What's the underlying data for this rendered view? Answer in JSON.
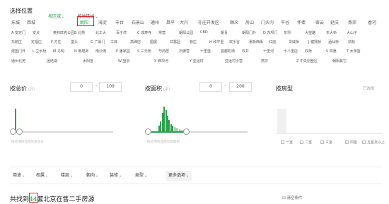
{
  "location": {
    "title": "选择位置",
    "tab_district": "按区域",
    "tab_subway": "按地铁线",
    "districts": [
      "东城",
      "西城",
      "朝阳",
      "海淀",
      "丰台",
      "石景山",
      "通州",
      "昌平",
      "大兴",
      "亦庄开发区",
      "顺义",
      "房山",
      "门头沟",
      "平谷",
      "怀柔",
      "密云",
      "延庆",
      "燕郊",
      "香河"
    ],
    "selected_district": "朝阳",
    "areas": [
      [
        "A 安定门",
        "安贞",
        "奥林匹克公园",
        "B 北苑",
        "北工大",
        "百子湾",
        "C 成寿寺",
        "常营",
        "朝阳公园",
        "CBD",
        "朝青",
        "朝阳门外",
        "D 东坝门",
        "东坝",
        "大望路",
        "东大桥",
        "大山子"
      ],
      [
        "东鹅庄",
        "定福庄",
        "F 方庄",
        "垡头",
        "G 广渠门",
        "工体",
        "高碑店",
        "国展",
        "甘露园",
        "管庄",
        "H 和平里",
        "欢乐谷",
        "惠新西街",
        "红庙",
        "华威桥",
        "J 健翔桥",
        "酒仙桥",
        "劲松"
      ],
      [
        "建国门外",
        "L 立水桥",
        "M 马甸",
        "N 南磨房",
        "南沙滩",
        "P 潘家园",
        "S 三元桥",
        "芍药居",
        "石佛营",
        "十里堡",
        "首都机场",
        "双井",
        "十里河",
        "十八里店",
        "双桥",
        "S 四惠",
        "T 太阳宫"
      ],
      [
        "通州北苑",
        "团结湖",
        "太阳宫",
        "W 望京",
        "X 西坝河",
        "Y 亚运村",
        "亚运村小营",
        "燕莎",
        "Z 中央别墅区",
        "朝阳其它"
      ]
    ]
  },
  "price": {
    "title": "按总价",
    "unit": "(万)",
    "min": "0",
    "max": "100",
    "hint": "拖动滑块选择房屋总价"
  },
  "area": {
    "title": "按面积",
    "unit": "(平)",
    "min": "0",
    "max": "200",
    "hint": "拖动滑块选择房屋面积"
  },
  "rooms": {
    "title": "按房型",
    "selected_label": "已选择",
    "options": [
      "一室",
      "二室",
      "三室",
      "四室",
      "五室及以上"
    ]
  },
  "filters": [
    "用途",
    "权属",
    "楼层",
    "朝向",
    "装修",
    "类型"
  ],
  "more_button": "更多选项",
  "result": {
    "prefix": "共找到",
    "count": "44",
    "suffix": "套北京在售二手房源"
  },
  "clear_label": "清空条件",
  "colors": {
    "accent": "#2fa04d",
    "highlight": "#e3262d"
  }
}
